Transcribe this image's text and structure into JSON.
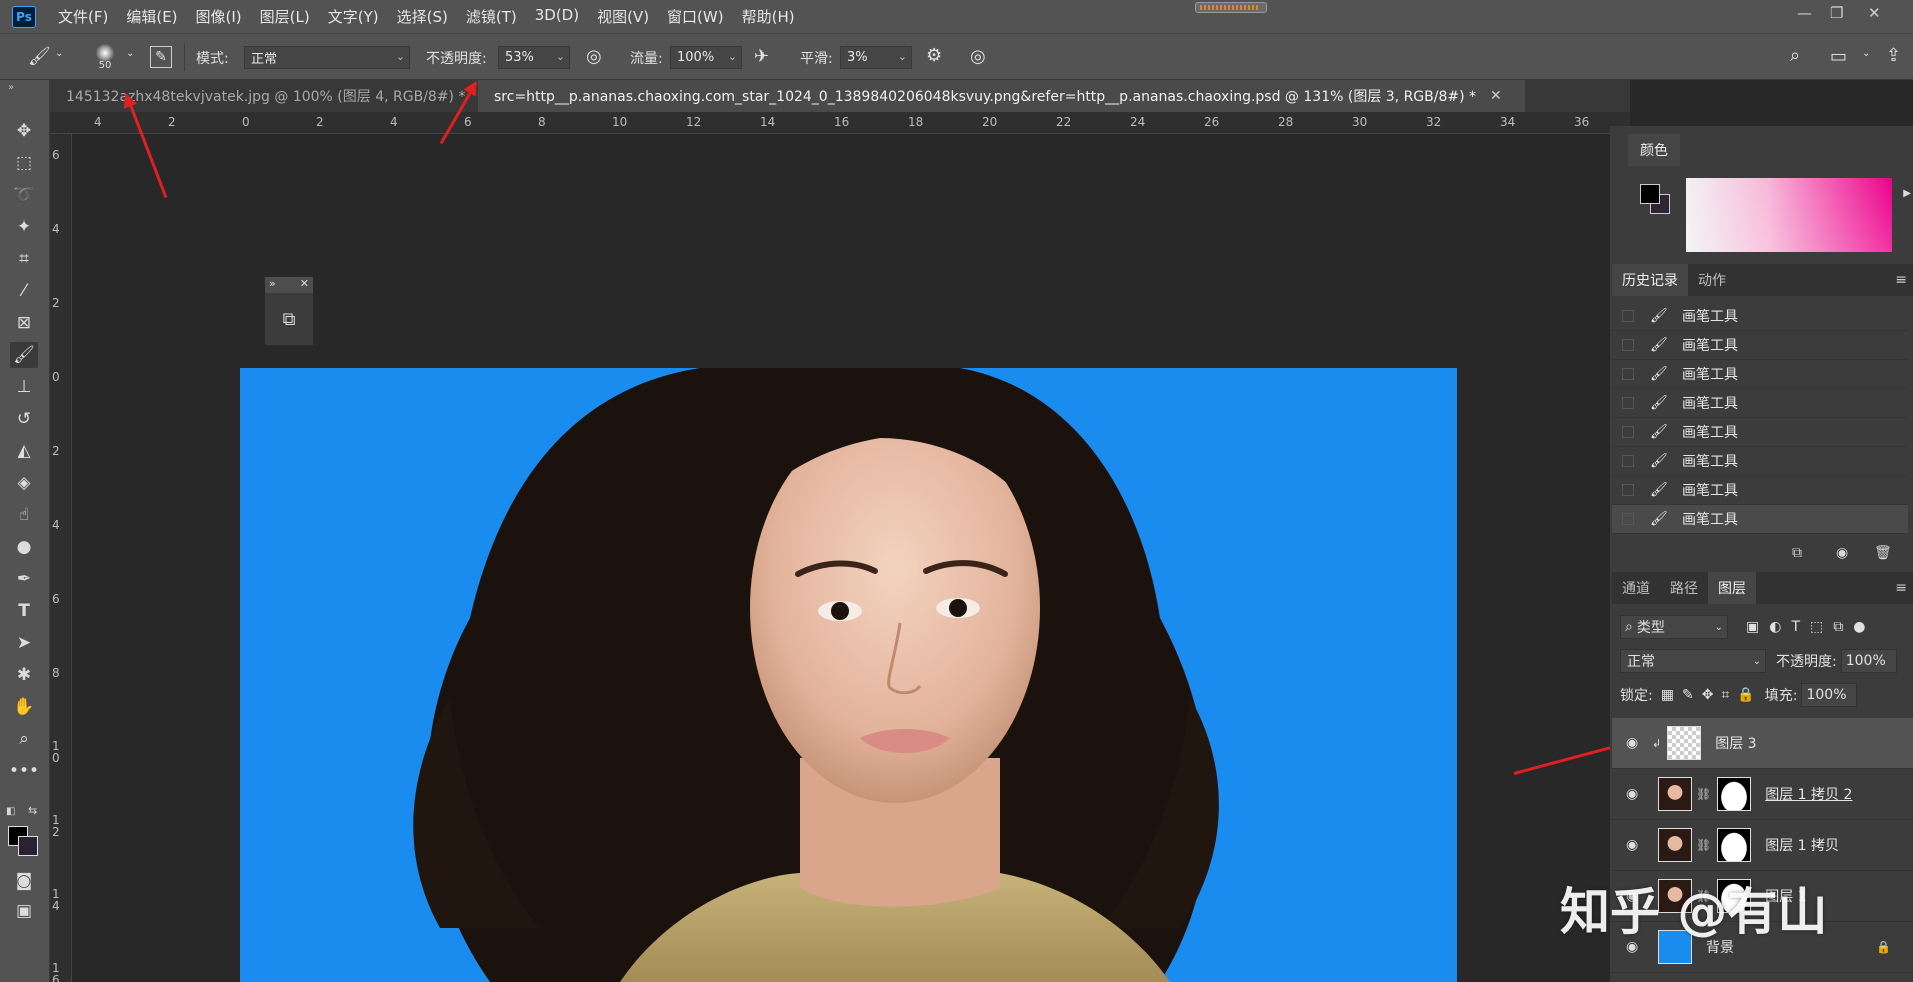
{
  "app": {
    "logo_text": "Ps",
    "menus": [
      "文件(F)",
      "编辑(E)",
      "图像(I)",
      "图层(L)",
      "文字(Y)",
      "选择(S)",
      "滤镜(T)",
      "3D(D)",
      "视图(V)",
      "窗口(W)",
      "帮助(H)"
    ]
  },
  "options": {
    "brush_size": "50",
    "mode_label": "模式:",
    "mode_value": "正常",
    "opacity_label": "不透明度:",
    "opacity_value": "53%",
    "flow_label": "流量:",
    "flow_value": "100%",
    "smooth_label": "平滑:",
    "smooth_value": "3%"
  },
  "tabs": [
    {
      "label": "145132azhx48tekvjvatek.jpg @ 100% (图层 4, RGB/8#) *",
      "active": false
    },
    {
      "label": "src=http__p.ananas.chaoxing.com_star_1024_0_1389840206048ksvuy.png&refer=http__p.ananas.chaoxing.psd @ 131% (图层 3, RGB/8#) *",
      "active": true
    }
  ],
  "ruler": {
    "h": [
      "4",
      "2",
      "0",
      "2",
      "4",
      "6",
      "8",
      "10",
      "12",
      "14",
      "16",
      "18",
      "20",
      "22",
      "24",
      "26",
      "28",
      "30",
      "32",
      "34",
      "36"
    ],
    "v": [
      "6",
      "4",
      "2",
      "0",
      "2",
      "4",
      "6",
      "8",
      "1\n0",
      "1\n2",
      "1\n4",
      "1\n6"
    ]
  },
  "color_panel": {
    "title": "颜色"
  },
  "history_panel": {
    "tabs": [
      "历史记录",
      "动作"
    ],
    "items": [
      "画笔工具",
      "画笔工具",
      "画笔工具",
      "画笔工具",
      "画笔工具",
      "画笔工具",
      "画笔工具",
      "画笔工具"
    ]
  },
  "layers_panel": {
    "tabs": [
      "通道",
      "路径",
      "图层"
    ],
    "filter_label": "类型",
    "blend_mode": "正常",
    "opacity_label": "不透明度:",
    "opacity_value": "100%",
    "lock_label": "锁定:",
    "fill_label": "填充:",
    "fill_value": "100%",
    "layers": [
      {
        "name": "图层 3",
        "selected": true
      },
      {
        "name": "图层 1 拷贝 2",
        "selected": false
      },
      {
        "name": "图层 1 拷贝",
        "selected": false
      },
      {
        "name": "图层 1",
        "selected": false
      },
      {
        "name": "背景",
        "selected": false
      }
    ]
  },
  "watermark": "知乎 @有山",
  "colors": {
    "canvas_bg": "#1a8cf0",
    "annotation_arrow": "#e02020",
    "ui_bg": "#535353"
  }
}
